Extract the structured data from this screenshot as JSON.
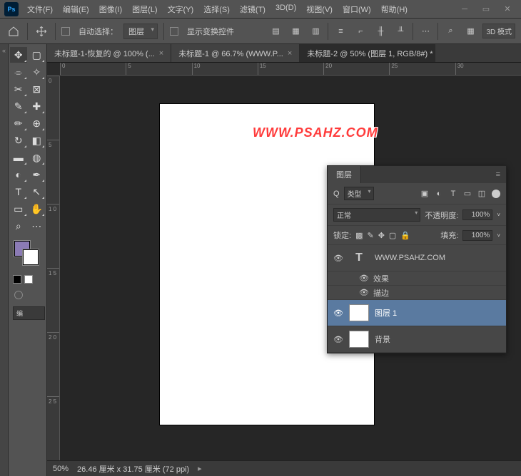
{
  "menu": [
    "文件(F)",
    "编辑(E)",
    "图像(I)",
    "图层(L)",
    "文字(Y)",
    "选择(S)",
    "滤镜(T)",
    "3D(D)",
    "视图(V)",
    "窗口(W)",
    "帮助(H)"
  ],
  "optbar": {
    "auto_select": "自动选择：",
    "layer": "图层",
    "show_transform": "显示变换控件",
    "mode3d": "3D 模式"
  },
  "tabs": [
    {
      "label": "未标题-1-恢复的 @ 100% (...",
      "active": false
    },
    {
      "label": "未标题-1 @ 66.7% (WWW.P...",
      "active": false
    },
    {
      "label": "未标题-2 @ 50% (图层 1, RGB/8#) *",
      "active": true
    }
  ],
  "ruler_h": [
    "0",
    "5",
    "10",
    "15",
    "20",
    "25",
    "30"
  ],
  "ruler_v": [
    "0",
    "5",
    "1 0",
    "1 5",
    "2 0",
    "2 5"
  ],
  "watermark": "WWW.PSAHZ.COM",
  "status": {
    "zoom": "50%",
    "info": "26.46 厘米 x 31.75 厘米 (72 ppi)"
  },
  "layers": {
    "title": "图层",
    "filter": "类型",
    "blend": "正常",
    "opacity_label": "不透明度:",
    "opacity": "100%",
    "fill_label": "填充:",
    "fill": "100%",
    "lock_label": "锁定:",
    "search_prefix": "Q",
    "items": [
      {
        "type": "text",
        "name": "WWW.PSAHZ.COM",
        "fx": true,
        "fx_label": "效果",
        "stroke": "描边"
      },
      {
        "type": "normal",
        "name": "图层 1",
        "selected": true
      },
      {
        "type": "normal",
        "name": "背景"
      }
    ]
  },
  "swatch": {
    "fg": "#8b7bb5",
    "bg": "#ffffff"
  },
  "edit_btn": "编"
}
